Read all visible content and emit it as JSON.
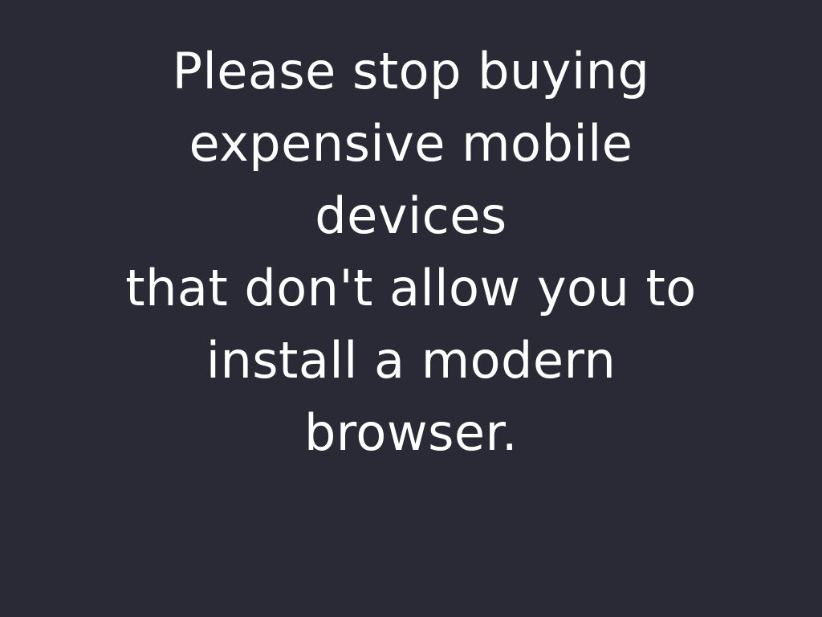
{
  "background_color": "#292a35",
  "text_color": "#ffffff",
  "message": {
    "line1": "Please stop buying",
    "line2": "expensive mobile",
    "line3": "devices",
    "line4": "that don't allow you to",
    "line5": "install a modern",
    "line6": "browser."
  }
}
